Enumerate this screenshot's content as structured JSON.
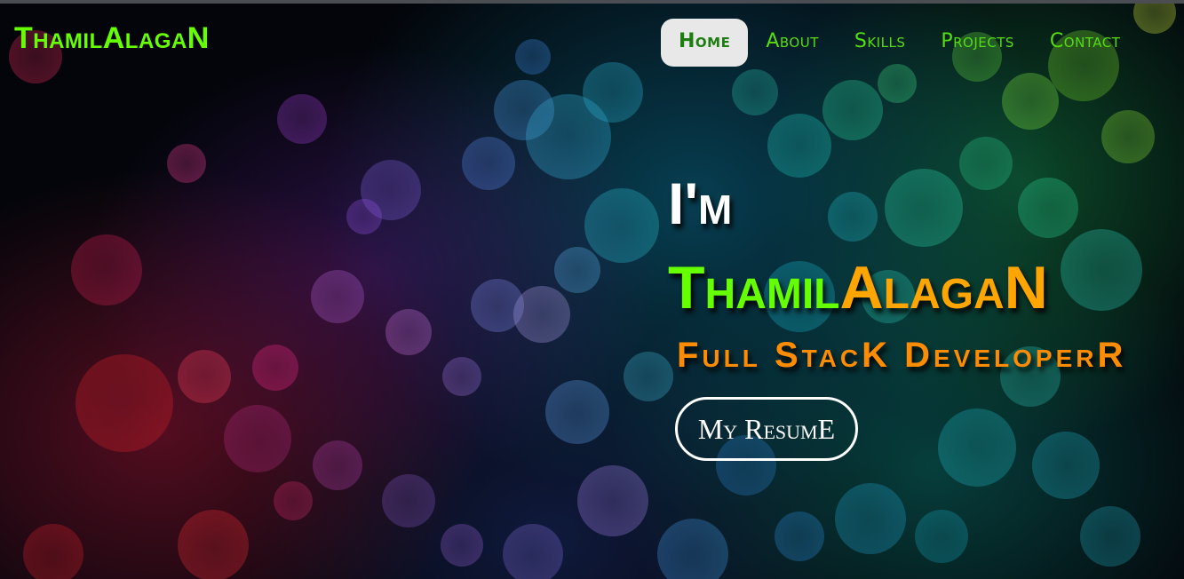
{
  "brand": {
    "logo": "ThamilAlagaN"
  },
  "nav": {
    "items": [
      {
        "label": "Home",
        "active": true
      },
      {
        "label": "About",
        "active": false
      },
      {
        "label": "Skills",
        "active": false
      },
      {
        "label": "Projects",
        "active": false
      },
      {
        "label": "Contact",
        "active": false
      }
    ]
  },
  "hero": {
    "greeting": "I'm",
    "name_part1": "Thamil",
    "name_part2": "AlagaN",
    "role": "Full StacK DeveloperR",
    "resume_button": "My ResumE"
  },
  "colors": {
    "accent_green": "#66ff00",
    "accent_orange": "#ffa500",
    "nav_active_bg": "#e8e8e8",
    "background": "#03050a"
  }
}
